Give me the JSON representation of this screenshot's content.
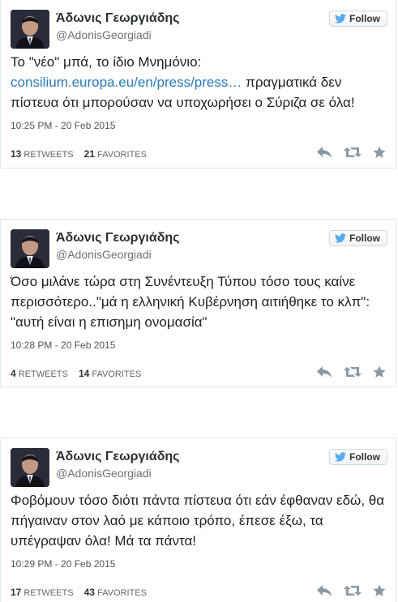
{
  "tweets": [
    {
      "name": "Άδωνις Γεωργιάδης",
      "handle": "@AdonisGeorgiadi",
      "follow_label": "Follow",
      "text_pre": "Το \"νέο\" μπά, το ίδιο Μνημόνιο: ",
      "link": "consilium.europa.eu/en/press/press…",
      "text_post": " πραγματικά δεν πίστευα ότι μπορούσαν να υποχωρήσει ο Σύριζα σε όλα!",
      "time": "10:25 PM - 20 Feb 2015",
      "retweets": "13",
      "retweets_label": "RETWEETS",
      "favorites": "21",
      "favorites_label": "FAVORITES"
    },
    {
      "name": "Άδωνις Γεωργιάδης",
      "handle": "@AdonisGeorgiadi",
      "follow_label": "Follow",
      "text": "Όσο μιλάνε τώρα στη Συνέντευξη Τύπου τόσο τους καίνε περισσότερο..\"μά η ελληνική Κυβέρνηση αιτιήθηκε το κλπ\": \"αυτή είναι η επισημη ονομασία\"",
      "time": "10:28 PM - 20 Feb 2015",
      "retweets": "4",
      "retweets_label": "RETWEETS",
      "favorites": "14",
      "favorites_label": "FAVORITES"
    },
    {
      "name": "Άδωνις Γεωργιάδης",
      "handle": "@AdonisGeorgiadi",
      "follow_label": "Follow",
      "text": "Φοβόμουν τόσο διότι πάντα πίστευα ότι εάν έφθαναν εδώ, θα πήγαιναν στον λαό με κάποιο τρόπο, έπεσε έξω, τα υπέγραψαν όλα! Μά τα πάντα!",
      "time": "10:29 PM - 20 Feb 2015",
      "retweets": "17",
      "retweets_label": "RETWEETS",
      "favorites": "43",
      "favorites_label": "FAVORITES"
    }
  ],
  "icons": {
    "reply": "reply-icon",
    "retweet": "retweet-icon",
    "favorite": "star-icon",
    "bird": "twitter-bird-icon"
  },
  "colors": {
    "link": "#2b7bb9",
    "bird": "#55acee",
    "action_icon": "#8899a6"
  }
}
